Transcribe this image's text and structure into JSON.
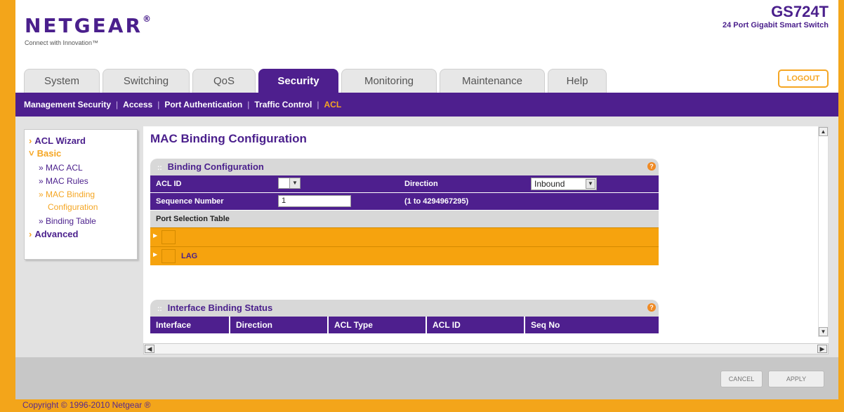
{
  "brand": {
    "name": "NETGEAR",
    "reg_mark": "®",
    "tagline": "Connect with Innovation™",
    "model": "GS724T",
    "model_desc": "24 Port Gigabit Smart Switch"
  },
  "tabs": [
    {
      "label": "System",
      "active": false
    },
    {
      "label": "Switching",
      "active": false
    },
    {
      "label": "QoS",
      "active": false
    },
    {
      "label": "Security",
      "active": true
    },
    {
      "label": "Monitoring",
      "active": false
    },
    {
      "label": "Maintenance",
      "active": false
    },
    {
      "label": "Help",
      "active": false
    }
  ],
  "logout_label": "LOGOUT",
  "subnav": [
    {
      "label": "Management Security",
      "active": false
    },
    {
      "label": "Access",
      "active": false
    },
    {
      "label": "Port Authentication",
      "active": false
    },
    {
      "label": "Traffic Control",
      "active": false
    },
    {
      "label": "ACL",
      "active": true
    }
  ],
  "sidebar": {
    "acl_wizard": "ACL Wizard",
    "basic": "Basic",
    "items": [
      {
        "label": "» MAC ACL",
        "active": false
      },
      {
        "label": "» MAC Rules",
        "active": false
      },
      {
        "label": "» MAC Binding",
        "active": true
      },
      {
        "label": "Configuration",
        "active": true
      },
      {
        "label": "» Binding Table",
        "active": false
      }
    ],
    "advanced": "Advanced"
  },
  "page_title": "MAC Binding Configuration",
  "binding_config": {
    "title": "Binding Configuration",
    "acl_id_label": "ACL ID",
    "acl_id_value": "",
    "direction_label": "Direction",
    "direction_value": "Inbound",
    "seq_label": "Sequence Number",
    "seq_value": "1",
    "seq_range": "(1 to 4294967295)",
    "port_selection_label": "Port Selection Table",
    "rows": [
      "",
      "LAG"
    ]
  },
  "interface_status": {
    "title": "Interface Binding Status",
    "columns": [
      "Interface",
      "Direction",
      "ACL Type",
      "ACL ID",
      "Seq No"
    ]
  },
  "buttons": {
    "cancel": "CANCEL",
    "apply": "APPLY"
  },
  "copyright": "Copyright © 1996-2010 Netgear ®",
  "colors": {
    "purple": "#4e1f8e",
    "orange": "#f6a30e"
  }
}
